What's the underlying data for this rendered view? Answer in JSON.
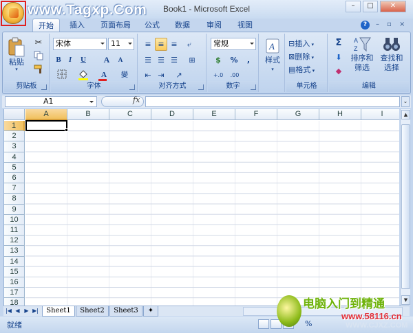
{
  "window": {
    "title": "Book1 - Microsoft Excel",
    "watermark_top": "www.Tagxp.Com",
    "controls": {
      "minimize": "–",
      "maximize": "□",
      "close": "✕"
    }
  },
  "ribbon_tabs": [
    "开始",
    "插入",
    "页面布局",
    "公式",
    "数据",
    "审阅",
    "视图"
  ],
  "active_tab": "开始",
  "clipboard": {
    "paste": "粘贴",
    "group": "剪贴板"
  },
  "font": {
    "name": "宋体",
    "size": "11",
    "bold": "B",
    "italic": "I",
    "underline": "U",
    "grow": "A",
    "shrink": "A",
    "color_a": "A",
    "wen": "變",
    "group": "字体"
  },
  "alignment": {
    "group": "对齐方式"
  },
  "number": {
    "format": "常规",
    "currency": "$",
    "percent": "%",
    "comma": ",",
    "inc": "+.0",
    "dec": ".00",
    "group": "数字"
  },
  "styles": {
    "label": "样式"
  },
  "cells": {
    "insert": "插入",
    "delete": "删除",
    "format": "格式",
    "group": "单元格"
  },
  "editing": {
    "sum": "Σ",
    "sort": "排序和",
    "sort2": "筛选",
    "find": "查找和",
    "find2": "选择",
    "group": "编辑"
  },
  "formula_bar": {
    "name_box": "A1",
    "fx": "fx",
    "formula": ""
  },
  "grid": {
    "columns": [
      "A",
      "B",
      "C",
      "D",
      "E",
      "F",
      "G",
      "H",
      "I"
    ],
    "rows": [
      "1",
      "2",
      "3",
      "4",
      "5",
      "6",
      "7",
      "8",
      "9",
      "10",
      "11",
      "12",
      "13",
      "14",
      "15",
      "16",
      "17",
      "18"
    ],
    "active_cell": "A1"
  },
  "sheets": [
    "Sheet1",
    "Sheet2",
    "Sheet3"
  ],
  "active_sheet": "Sheet1",
  "status": {
    "text": "就绪",
    "zoom": "%"
  },
  "watermark_bottom": {
    "title": "电脑入门到精通",
    "url": "www.58116.cn",
    "url2": "WWW.CJXZ.COM"
  },
  "colors": {
    "ribbon_bg": "#c7d9f0",
    "accent": "#15428b",
    "active_header": "#f1c15f",
    "grid_line": "#d0d7e5"
  }
}
